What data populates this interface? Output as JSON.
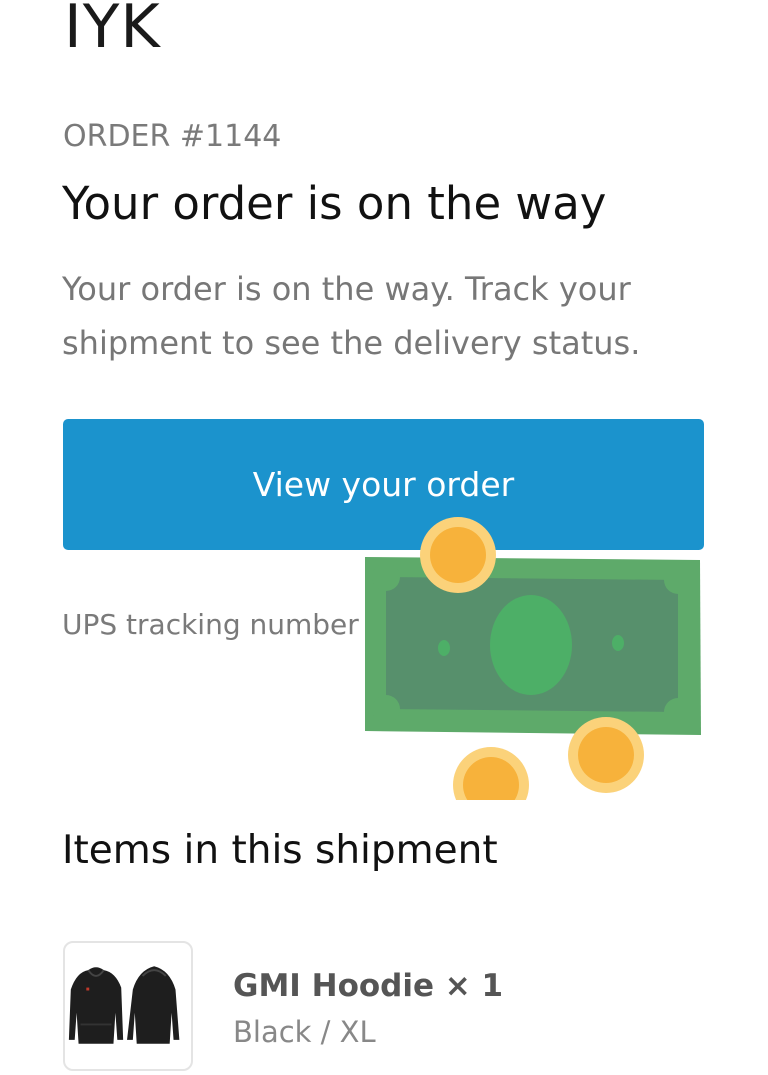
{
  "brand": {
    "name": "IYK"
  },
  "order": {
    "number_label": "ORDER #1144",
    "title": "Your order is on the way",
    "description": "Your order is on the way. Track your shipment to see the delivery status.",
    "cta_label": "View your order",
    "tracking_label": "UPS tracking number"
  },
  "shipment": {
    "section_title": "Items in this shipment",
    "items": [
      {
        "name": "GMI Hoodie × 1",
        "variant": "Black / XL"
      }
    ]
  },
  "colors": {
    "accent": "#1b93cd",
    "money_green": "#5eaa6a",
    "coin_gold": "#f7b23b"
  },
  "icons": {
    "overlay": "money-cash-icon",
    "item": "hoodie-icon"
  }
}
